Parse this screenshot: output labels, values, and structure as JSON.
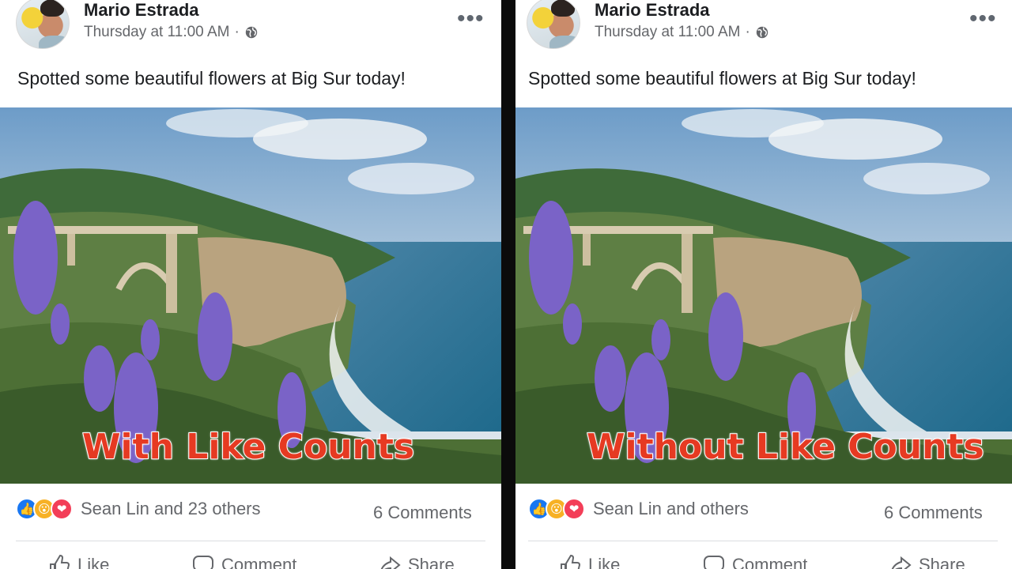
{
  "posts": [
    {
      "author": "Mario Estrada",
      "timestamp": "Thursday at 11:00 AM",
      "separator": "·",
      "privacy_icon": "globe-icon",
      "more_icon": "•••",
      "caption": "Spotted some beautiful flowers at Big Sur today!",
      "overlay_label": "With Like Counts",
      "reaction_icons": [
        "like-icon",
        "wow-icon",
        "love-icon"
      ],
      "reactions_text": "Sean Lin and 23 others",
      "comments_text": "6 Comments",
      "actions": {
        "like": "Like",
        "comment": "Comment",
        "share": "Share"
      }
    },
    {
      "author": "Mario Estrada",
      "timestamp": "Thursday at 11:00 AM",
      "separator": "·",
      "privacy_icon": "globe-icon",
      "more_icon": "•••",
      "caption": "Spotted some beautiful flowers at Big Sur today!",
      "overlay_label": "Without Like Counts",
      "reaction_icons": [
        "like-icon",
        "wow-icon",
        "love-icon"
      ],
      "reactions_text": "Sean Lin and others",
      "comments_text": "6 Comments",
      "actions": {
        "like": "Like",
        "comment": "Comment",
        "share": "Share"
      }
    }
  ],
  "colors": {
    "facebook_blue": "#1877f2",
    "wow_yellow": "#f7b125",
    "love_red": "#f33e58",
    "label_red": "#e63a22",
    "meta_gray": "#65676b"
  }
}
